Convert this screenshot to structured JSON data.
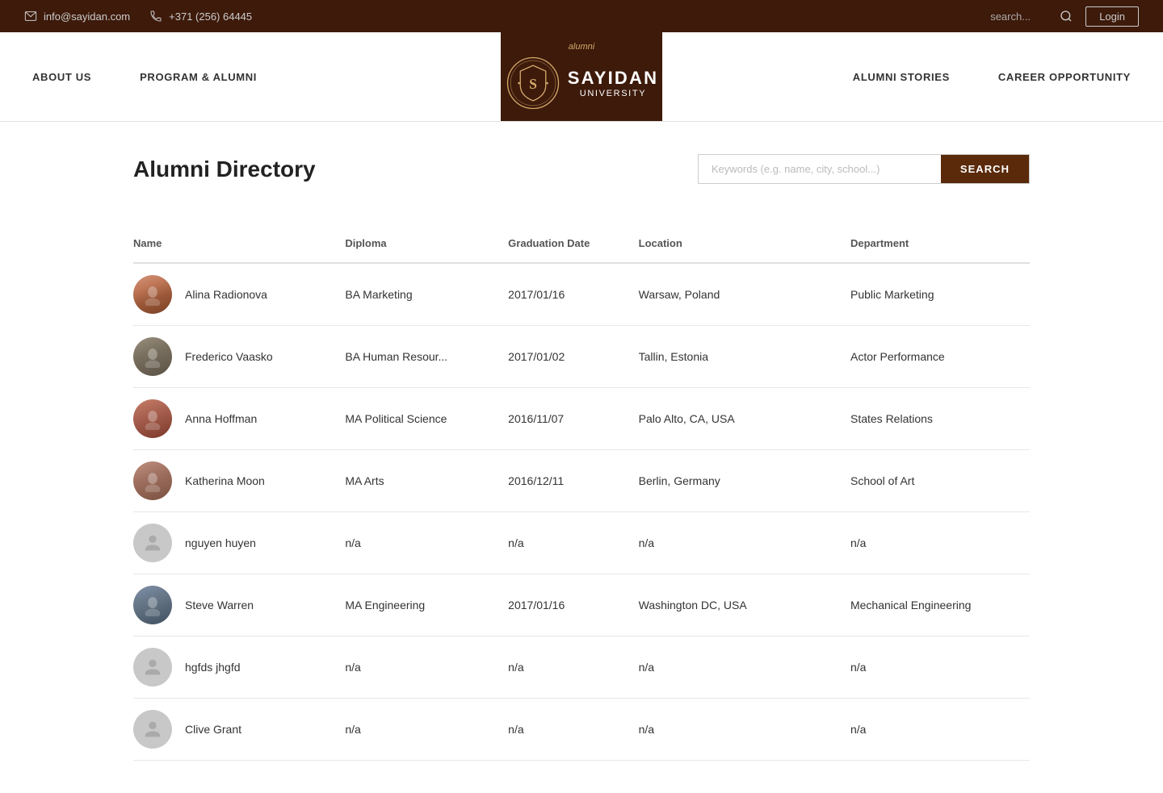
{
  "topbar": {
    "email": "info@sayidan.com",
    "phone": "+371 (256) 64445",
    "search_placeholder": "search...",
    "login_label": "Login"
  },
  "nav": {
    "left": [
      {
        "label": "ABOUT US",
        "id": "about-us"
      },
      {
        "label": "PROGRAM & ALUMNI",
        "id": "program-alumni"
      }
    ],
    "right": [
      {
        "label": "ALUMNI STORIES",
        "id": "alumni-stories"
      },
      {
        "label": "CAREER OPPORTUNITY",
        "id": "career-opportunity"
      }
    ],
    "logo": {
      "alumni_text": "alumni",
      "name": "SAYIDAN",
      "university": "UNIVERSITY"
    }
  },
  "main": {
    "title": "Alumni Directory",
    "search_placeholder": "Keywords (e.g. name, city, school...)",
    "search_button": "SEARCH",
    "table": {
      "headers": [
        "Name",
        "Diploma",
        "Graduation Date",
        "Location",
        "Department"
      ],
      "rows": [
        {
          "id": "alina",
          "name": "Alina Radionova",
          "diploma": "BA Marketing",
          "grad_date": "2017/01/16",
          "location": "Warsaw, Poland",
          "department": "Public Marketing",
          "has_photo": true,
          "avatar_style": "alina"
        },
        {
          "id": "frederico",
          "name": "Frederico Vaasko",
          "diploma": "BA Human Resour...",
          "grad_date": "2017/01/02",
          "location": "Tallin, Estonia",
          "department": "Actor Performance",
          "has_photo": true,
          "avatar_style": "frederico"
        },
        {
          "id": "anna",
          "name": "Anna Hoffman",
          "diploma": "MA Political Science",
          "grad_date": "2016/11/07",
          "location": "Palo Alto, CA, USA",
          "department": "States Relations",
          "has_photo": true,
          "avatar_style": "anna"
        },
        {
          "id": "katherina",
          "name": "Katherina Moon",
          "diploma": "MA Arts",
          "grad_date": "2016/12/11",
          "location": "Berlin, Germany",
          "department": "School of Art",
          "has_photo": true,
          "avatar_style": "katherina"
        },
        {
          "id": "nguyen",
          "name": "nguyen huyen",
          "diploma": "n/a",
          "grad_date": "n/a",
          "location": "n/a",
          "department": "n/a",
          "has_photo": false,
          "avatar_style": "placeholder"
        },
        {
          "id": "steve",
          "name": "Steve Warren",
          "diploma": "MA Engineering",
          "grad_date": "2017/01/16",
          "location": "Washington DC, USA",
          "department": "Mechanical Engineering",
          "has_photo": true,
          "avatar_style": "steve"
        },
        {
          "id": "hgfds",
          "name": "hgfds jhgfd",
          "diploma": "n/a",
          "grad_date": "n/a",
          "location": "n/a",
          "department": "n/a",
          "has_photo": false,
          "avatar_style": "placeholder"
        },
        {
          "id": "clive",
          "name": "Clive Grant",
          "diploma": "n/a",
          "grad_date": "n/a",
          "location": "n/a",
          "department": "n/a",
          "has_photo": false,
          "avatar_style": "placeholder"
        }
      ]
    }
  },
  "colors": {
    "brand_dark": "#3d1a0a",
    "brand_accent": "#5a2a0a",
    "brand_gold": "#d4a96a"
  }
}
